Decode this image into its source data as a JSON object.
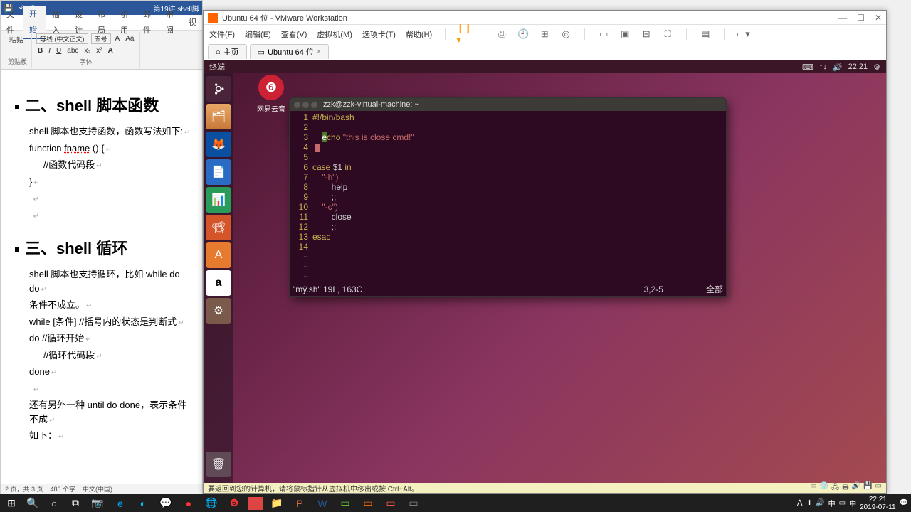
{
  "word": {
    "qat_title": "第19讲 shell脚",
    "tabs": [
      "文件",
      "开始",
      "插入",
      "设计",
      "布局",
      "引用",
      "邮件",
      "审阅",
      "视"
    ],
    "ribbon": {
      "clipboard": "粘贴",
      "clipboard_g": "剪贴板",
      "font": "等线 (中文正文)",
      "size": "五号",
      "font_g": "字体"
    },
    "doc": {
      "h1": "二、shell 脚本函数",
      "p1": "shell 脚本也支持函数，函数写法如下:",
      "p2a": "function ",
      "p2b": "fname",
      "p2c": " () {",
      "p3": "//函数代码段",
      "p4": "}",
      "h2": "三、shell 循环",
      "p5": "shell 脚本也支持循环，比如  while do do",
      "p6": "条件不成立。",
      "p7": "while [条件]   //括号内的状态是判断式",
      "p8": "do                   //循环开始",
      "p9": "//循环代码段",
      "p10": "done",
      "p11": "还有另外一种 until do done，表示条件不成",
      "p12": "如下："
    },
    "status": {
      "pages": "2 页，共 3 页",
      "words": "486 个字",
      "lang": "中文(中国)"
    }
  },
  "vmware": {
    "title": "Ubuntu 64 位 - VMware Workstation",
    "menu": [
      "文件(F)",
      "编辑(E)",
      "查看(V)",
      "虚拟机(M)",
      "选项卡(T)",
      "帮助(H)"
    ],
    "tab_home": "主页",
    "tab_vm": "Ubuntu 64 位",
    "hint": "要返回到您的计算机，请将鼠标指针从虚拟机中移出或按 Ctrl+Alt。"
  },
  "ubuntu": {
    "topbar_title": "终端",
    "time": "22:21",
    "desktop_icon": "网易云音",
    "term_title": "zzk@zzk-virtual-machine: ~",
    "code": {
      "l1": "#!/bin/bash",
      "l3a": "cho ",
      "l3b": "\"this is close cmd!\"",
      "l6a": "case",
      "l6b": " $1 ",
      "l6c": "in",
      "l7": "\"-h\")",
      "l8": "help",
      "l9": ";;",
      "l10": "\"-c\")",
      "l11": "close",
      "l12": ";;",
      "l13": "esac"
    },
    "vim_file": "\"my.sh\" 19L, 163C",
    "vim_pos": "3,2-5",
    "vim_pct": "全部"
  },
  "taskbar": {
    "time": "22:21",
    "date": "2019-07-11"
  }
}
